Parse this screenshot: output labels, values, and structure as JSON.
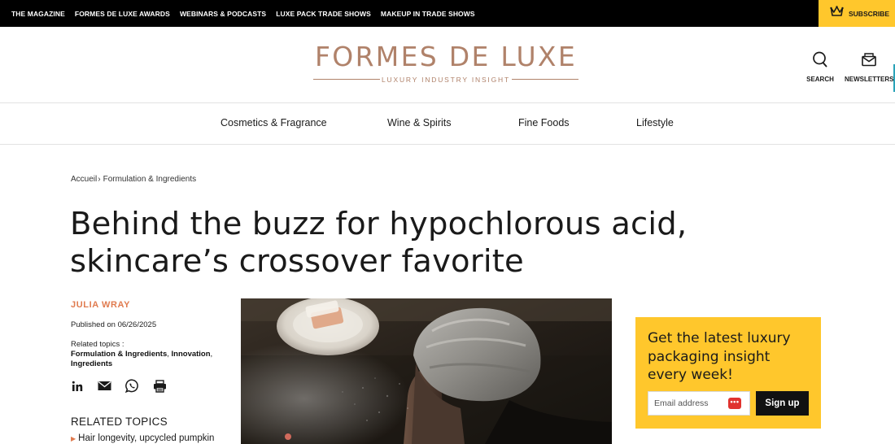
{
  "topnav": {
    "items": [
      "THE MAGAZINE",
      "FORMES DE LUXE AWARDS",
      "WEBINARS & PODCASTS",
      "LUXE PACK TRADE SHOWS",
      "MAKEUP IN TRADE SHOWS"
    ],
    "subscribe": "SUBSCRIBE"
  },
  "header": {
    "logo_name": "FORMES DE LUXE",
    "logo_tagline": "LUXURY INDUSTRY INSIGHT",
    "search_label": "SEARCH",
    "newsletters_label": "NEWSLETTERS"
  },
  "categories": [
    "Cosmetics & Fragrance",
    "Wine & Spirits",
    "Fine Foods",
    "Lifestyle"
  ],
  "breadcrumb": {
    "home": "Accueil",
    "current": "Formulation & Ingredients"
  },
  "article": {
    "title": "Behind the buzz for hypochlorous acid, skincare’s crossover favorite",
    "author": "JULIA WRAY",
    "published": "Published on 06/26/2025",
    "related_label": "Related topics :",
    "topics": [
      "Formulation & Ingredients",
      "Innovation",
      "Ingredients"
    ]
  },
  "share_icons": [
    "linkedin-icon",
    "email-icon",
    "whatsapp-icon",
    "print-icon"
  ],
  "related": {
    "heading": "RELATED TOPICS",
    "first_item": "Hair longevity, upcycled pumpkin"
  },
  "newsletter": {
    "heading": "Get the latest luxury packaging insight every week!",
    "email_placeholder": "Email address",
    "button": "Sign up"
  },
  "colors": {
    "accent_yellow": "#ffc72c",
    "brand_copper": "#b0826a",
    "author_orange": "#e07b4f",
    "topbar": "#000000"
  }
}
